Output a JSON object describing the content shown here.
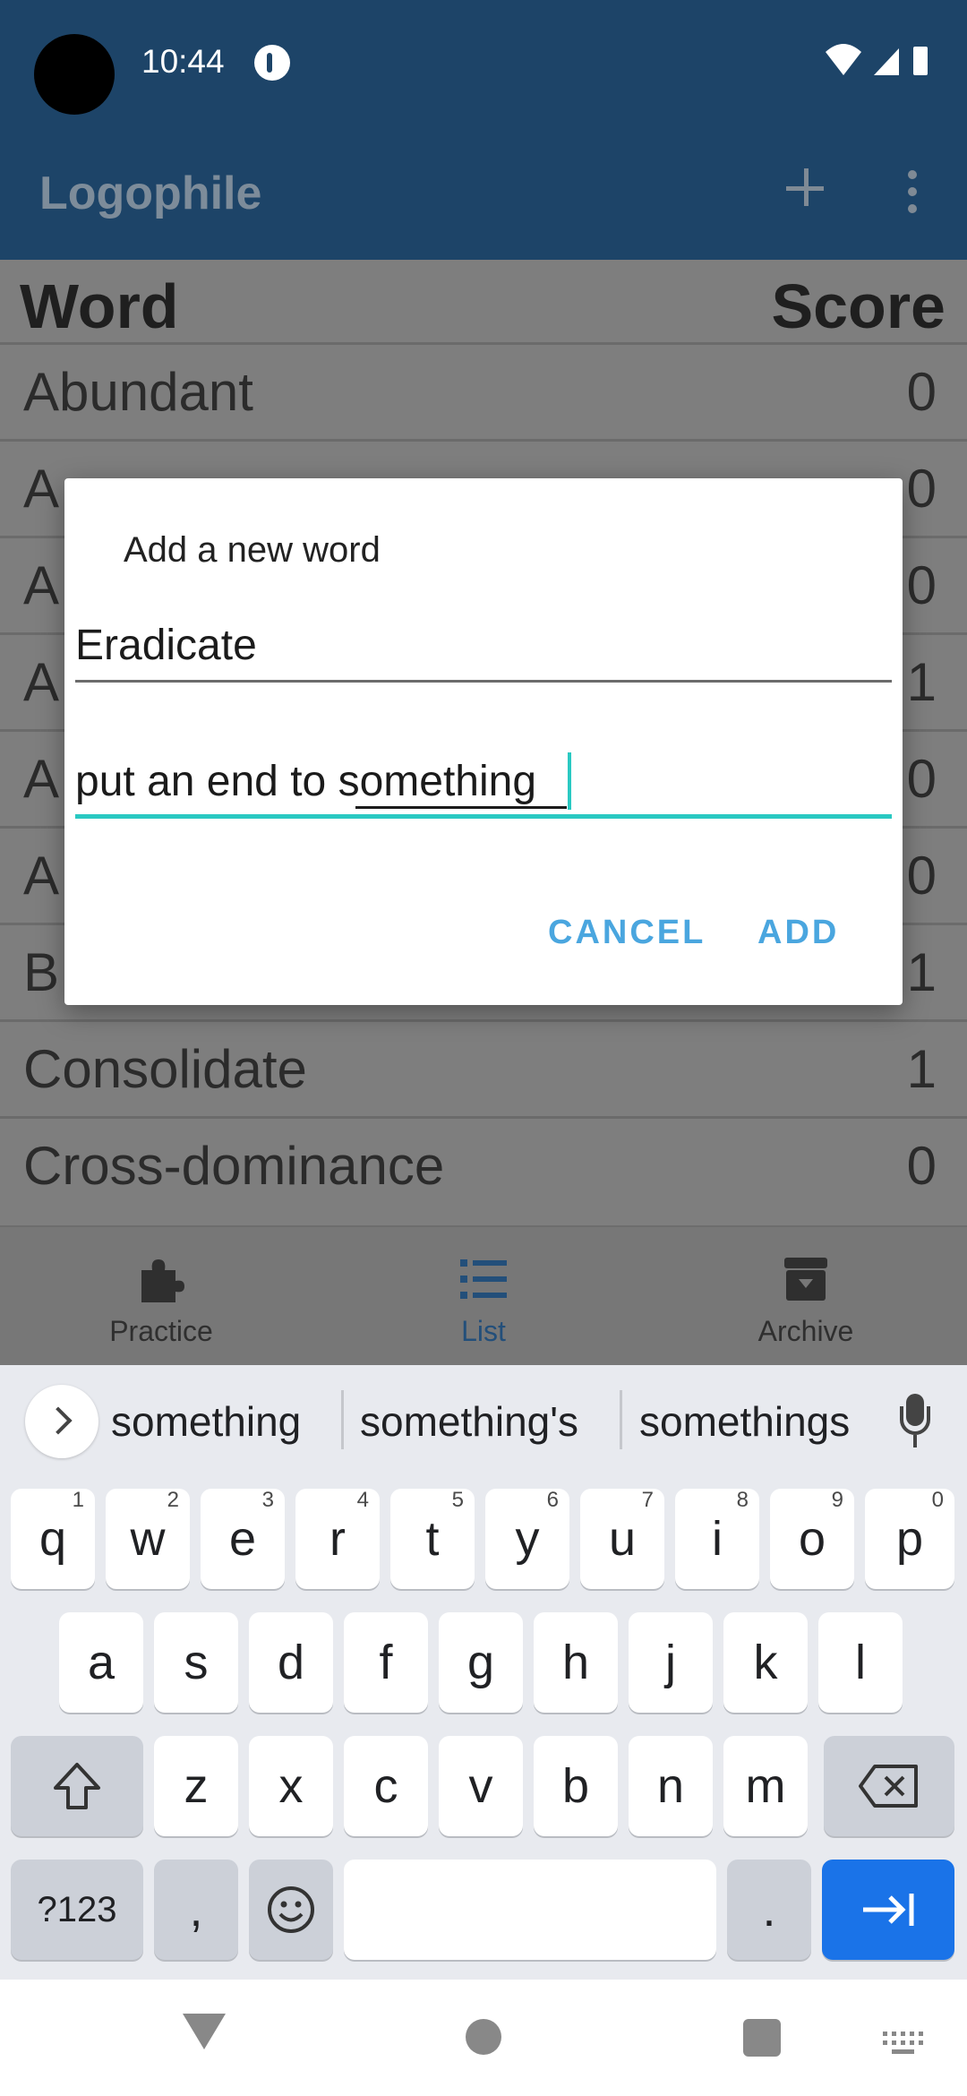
{
  "status_bar": {
    "time": "10:44"
  },
  "app_bar": {
    "title": "Logophile",
    "add_icon": "plus-icon",
    "more_icon": "more-vert-icon"
  },
  "table": {
    "header_word": "Word",
    "header_score": "Score",
    "rows": [
      {
        "word": "Abundant",
        "score": "0"
      },
      {
        "word": "A",
        "score": "0"
      },
      {
        "word": "A",
        "score": "0"
      },
      {
        "word": "A",
        "score": "1"
      },
      {
        "word": "A",
        "score": "0"
      },
      {
        "word": "A",
        "score": "0"
      },
      {
        "word": "B",
        "score": "1"
      },
      {
        "word": "Consolidate",
        "score": "1"
      },
      {
        "word": "Cross-dominance",
        "score": "0"
      }
    ]
  },
  "bottom_nav": {
    "items": [
      {
        "label": "Practice",
        "icon": "puzzle-icon",
        "color": "#2f2f2f"
      },
      {
        "label": "List",
        "icon": "list-icon",
        "color": "#234f7a"
      },
      {
        "label": "Archive",
        "icon": "archive-icon",
        "color": "#2f2f2f"
      }
    ]
  },
  "dialog": {
    "title": "Add a new word",
    "word_value": "Eradicate",
    "definition_value": "put an end to something",
    "cancel_label": "CANCEL",
    "add_label": "ADD",
    "accent_color": "#2ac9c2",
    "button_color": "#4aa6df"
  },
  "keyboard": {
    "suggestions": [
      "something",
      "something's",
      "somethings"
    ],
    "row1": [
      {
        "key": "q",
        "hint": "1"
      },
      {
        "key": "w",
        "hint": "2"
      },
      {
        "key": "e",
        "hint": "3"
      },
      {
        "key": "r",
        "hint": "4"
      },
      {
        "key": "t",
        "hint": "5"
      },
      {
        "key": "y",
        "hint": "6"
      },
      {
        "key": "u",
        "hint": "7"
      },
      {
        "key": "i",
        "hint": "8"
      },
      {
        "key": "o",
        "hint": "9"
      },
      {
        "key": "p",
        "hint": "0"
      }
    ],
    "row2": [
      "a",
      "s",
      "d",
      "f",
      "g",
      "h",
      "j",
      "k",
      "l"
    ],
    "row3": [
      "z",
      "x",
      "c",
      "v",
      "b",
      "n",
      "m"
    ],
    "symbols_label": "?123",
    "comma_label": ",",
    "period_label": ".",
    "shift_icon": "shift-icon",
    "backspace_icon": "backspace-icon",
    "emoji_icon": "emoji-icon",
    "enter_icon": "tab-arrow-icon",
    "enter_color": "#1a73e8"
  }
}
